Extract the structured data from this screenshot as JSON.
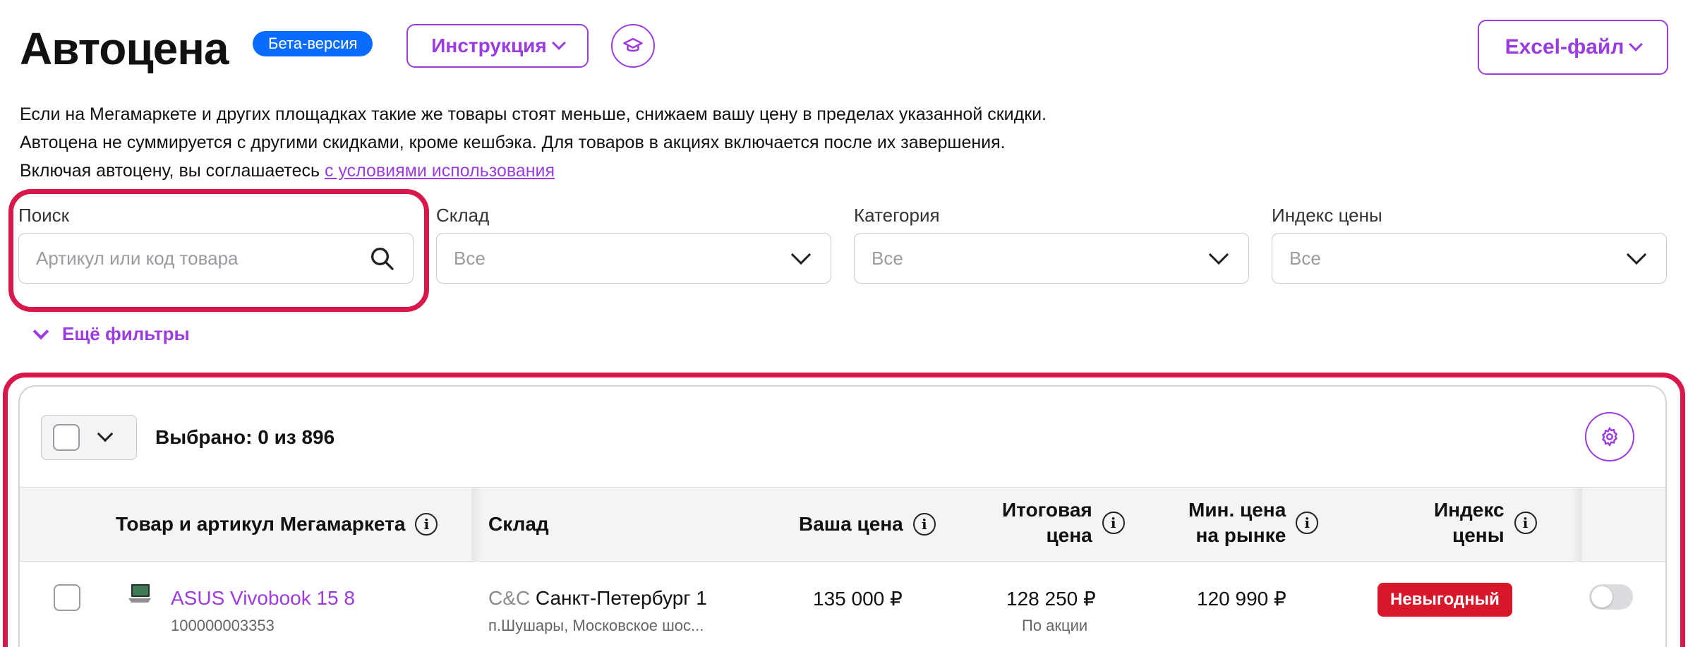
{
  "header": {
    "title": "Автоцена",
    "beta_badge": "Бета-версия",
    "instructions_label": "Инструкция",
    "excel_label": "Excel-файл"
  },
  "description": {
    "line1": "Если на Мегамаркете и других площадках такие же товары стоят меньше, снижаем вашу цену в пределах указанной скидки.",
    "line2": "Автоцена не суммируется с другими скидками, кроме кешбэка. Для товаров в акциях включается после их завершения.",
    "line3_prefix": "Включая автоцену, вы соглашаетесь ",
    "line3_link": "с условиями использования"
  },
  "filters": {
    "search": {
      "label": "Поиск",
      "placeholder": "Артикул или код товара"
    },
    "warehouse": {
      "label": "Склад",
      "value": "Все"
    },
    "category": {
      "label": "Категория",
      "value": "Все"
    },
    "price_index": {
      "label": "Индекс цены",
      "value": "Все"
    },
    "more_filters": "Ещё фильтры"
  },
  "table": {
    "selected_text": "Выбрано: 0 из 896",
    "columns": {
      "product": "Товар и артикул Мегамаркета",
      "warehouse": "Склад",
      "your_price": "Ваша цена",
      "final_price_1": "Итоговая",
      "final_price_2": "цена",
      "min_price_1": "Мин. цена",
      "min_price_2": "на рынке",
      "index_1": "Индекс",
      "index_2": "цены"
    },
    "rows": [
      {
        "product_name": "ASUS Vivobook 15 8",
        "product_code": "100000003353",
        "warehouse_prefix": "C&C",
        "warehouse_name": " Санкт-Петербург 1",
        "warehouse_address": "п.Шушары, Московское шос...",
        "your_price": "135 000 ₽",
        "final_price": "128 250 ₽",
        "final_price_note": "По акции",
        "min_market_price": "120 990 ₽",
        "price_index_badge": "Невыгодный",
        "autoprice_enabled": false
      }
    ]
  },
  "colors": {
    "accent": "#9b3ce0",
    "beta": "#0a6cff",
    "highlight": "#d8174a",
    "badge_bad": "#d8172a"
  }
}
